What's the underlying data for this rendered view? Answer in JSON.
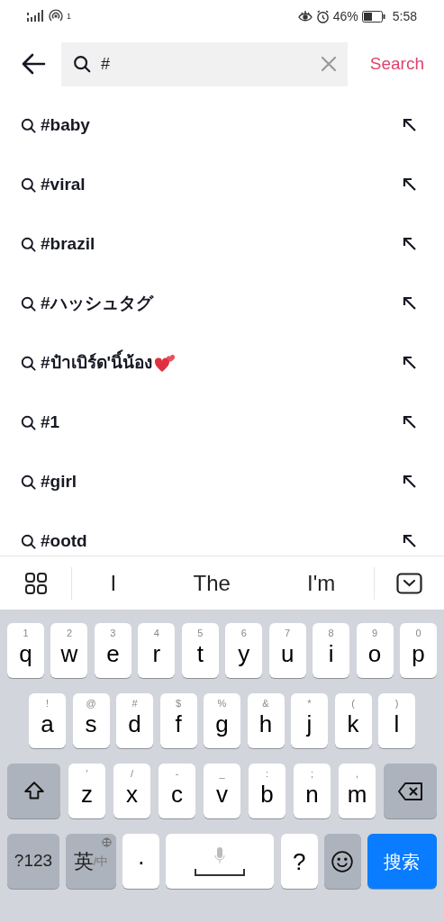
{
  "status_bar": {
    "sim_badge": "1",
    "battery_percent": "46%",
    "time": "5:58"
  },
  "header": {
    "query": "#",
    "search_button": "Search"
  },
  "suggestions": [
    {
      "text": "#baby",
      "hearts": false
    },
    {
      "text": "#viral",
      "hearts": false
    },
    {
      "text": "#brazil",
      "hearts": false
    },
    {
      "text": "#ハッシュタグ",
      "hearts": false
    },
    {
      "text": "#ป๋าเบิร์ด'นิ์น้อง",
      "hearts": true
    },
    {
      "text": "#1",
      "hearts": false
    },
    {
      "text": "#girl",
      "hearts": false
    },
    {
      "text": "#ootd",
      "hearts": false
    }
  ],
  "word_bar": [
    "I",
    "The",
    "I'm"
  ],
  "keyboard": {
    "rows": [
      [
        {
          "kind": "char",
          "label": "q",
          "hint": "1"
        },
        {
          "kind": "char",
          "label": "w",
          "hint": "2"
        },
        {
          "kind": "char",
          "label": "e",
          "hint": "3"
        },
        {
          "kind": "char",
          "label": "r",
          "hint": "4"
        },
        {
          "kind": "char",
          "label": "t",
          "hint": "5"
        },
        {
          "kind": "char",
          "label": "y",
          "hint": "6"
        },
        {
          "kind": "char",
          "label": "u",
          "hint": "7"
        },
        {
          "kind": "char",
          "label": "i",
          "hint": "8"
        },
        {
          "kind": "char",
          "label": "o",
          "hint": "9"
        },
        {
          "kind": "char",
          "label": "p",
          "hint": "0"
        }
      ],
      [
        {
          "kind": "char",
          "label": "a",
          "hint": "!"
        },
        {
          "kind": "char",
          "label": "s",
          "hint": "@"
        },
        {
          "kind": "char",
          "label": "d",
          "hint": "#"
        },
        {
          "kind": "char",
          "label": "f",
          "hint": "$"
        },
        {
          "kind": "char",
          "label": "g",
          "hint": "%"
        },
        {
          "kind": "char",
          "label": "h",
          "hint": "&"
        },
        {
          "kind": "char",
          "label": "j",
          "hint": "*"
        },
        {
          "kind": "char",
          "label": "k",
          "hint": "("
        },
        {
          "kind": "char",
          "label": "l",
          "hint": ")"
        }
      ],
      [
        {
          "kind": "shift"
        },
        {
          "kind": "char",
          "label": "z",
          "hint": "'"
        },
        {
          "kind": "char",
          "label": "x",
          "hint": "/"
        },
        {
          "kind": "char",
          "label": "c",
          "hint": "-"
        },
        {
          "kind": "char",
          "label": "v",
          "hint": "_"
        },
        {
          "kind": "char",
          "label": "b",
          "hint": ":"
        },
        {
          "kind": "char",
          "label": "n",
          "hint": ";"
        },
        {
          "kind": "char",
          "label": "m",
          "hint": ","
        },
        {
          "kind": "backspace"
        }
      ],
      [
        {
          "kind": "mode",
          "label": "?123"
        },
        {
          "kind": "lang",
          "label": "英",
          "sub": "/中"
        },
        {
          "kind": "char",
          "label": "·"
        },
        {
          "kind": "space"
        },
        {
          "kind": "char",
          "label": "?"
        },
        {
          "kind": "emoji"
        },
        {
          "kind": "enter",
          "label": "搜索"
        }
      ]
    ]
  }
}
